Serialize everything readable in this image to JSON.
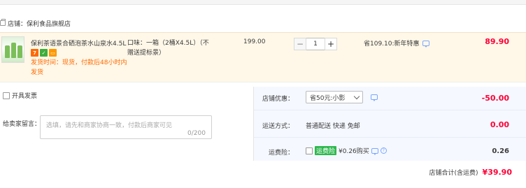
{
  "shop": {
    "label": "店铺：保利食品旗舰店"
  },
  "item": {
    "title": "保利茶语景合硒泡茶水山泉水4.5L",
    "badges": [
      {
        "name": "badge-7day",
        "text": "7",
        "color": "#ff6a00"
      },
      {
        "name": "badge-green",
        "text": "",
        "color": "#3fae3c"
      },
      {
        "name": "badge-card",
        "text": "",
        "color": "#ff9800"
      }
    ],
    "shipping": "发货时间：现货，付款后48小时内发货",
    "spec": "口味：一箱（2桶X4.5L）（不赠送提标景）",
    "unit_price": "199.00",
    "quantity": "1",
    "discount": "省109.10:新年特惠",
    "subtotal": "89.90"
  },
  "invoice": {
    "label": "开具发票"
  },
  "message": {
    "label": "给卖家留言：",
    "placeholder": "选填，请先和商家协商一致，付款后商家可见",
    "count": "0/200"
  },
  "coupon": {
    "label": "店铺优惠：",
    "selected": "省50元:小影",
    "amount": "-50.00"
  },
  "delivery": {
    "label": "运送方式：",
    "method": "普通配送 快递 免邮",
    "amount": "0.00"
  },
  "insurance": {
    "label": "运费险：",
    "tag": "运费险",
    "text": "¥0.26购买",
    "amount": "0.26"
  },
  "total": {
    "label": "店铺合计(含运费)",
    "amount": "¥39.90"
  },
  "colors": {
    "accent": "#ff0036",
    "orange": "#ff6a00",
    "panel_bg": "#f5f8ff"
  }
}
